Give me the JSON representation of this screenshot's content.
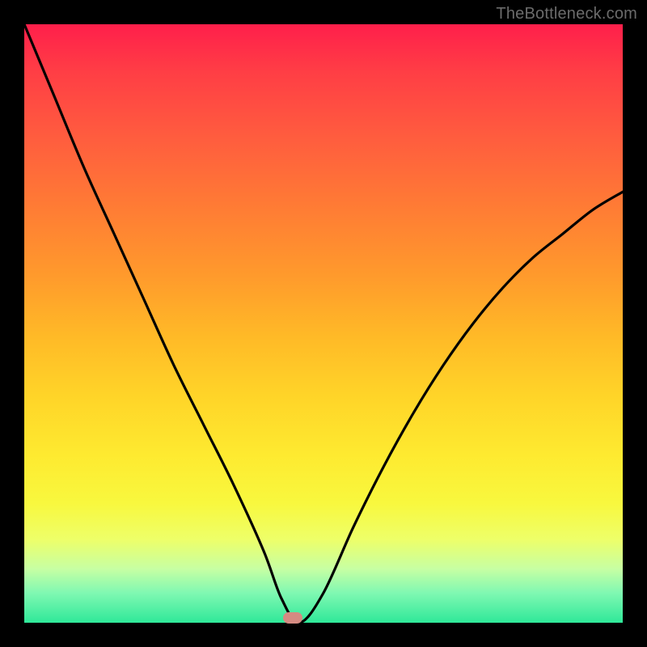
{
  "watermark": "TheBottleneck.com",
  "marker": {
    "x_frac": 0.448,
    "y_frac": 0.992
  },
  "chart_data": {
    "type": "line",
    "title": "",
    "xlabel": "",
    "ylabel": "",
    "xlim": [
      0,
      1
    ],
    "ylim": [
      0,
      1
    ],
    "series": [
      {
        "name": "bottleneck-curve",
        "x": [
          0.0,
          0.05,
          0.1,
          0.15,
          0.2,
          0.25,
          0.3,
          0.35,
          0.4,
          0.43,
          0.46,
          0.5,
          0.55,
          0.6,
          0.65,
          0.7,
          0.75,
          0.8,
          0.85,
          0.9,
          0.95,
          1.0
        ],
        "y": [
          1.0,
          0.88,
          0.76,
          0.65,
          0.54,
          0.43,
          0.33,
          0.23,
          0.12,
          0.04,
          0.0,
          0.05,
          0.16,
          0.26,
          0.35,
          0.43,
          0.5,
          0.56,
          0.61,
          0.65,
          0.69,
          0.72
        ]
      }
    ],
    "annotations": [
      {
        "type": "marker",
        "x": 0.448,
        "y": 0.008,
        "label": "optimal-point"
      }
    ],
    "gradient_colors_top_to_bottom": [
      "#ff1f4b",
      "#ff7a35",
      "#ffd428",
      "#f8f83e",
      "#2fe899"
    ]
  }
}
